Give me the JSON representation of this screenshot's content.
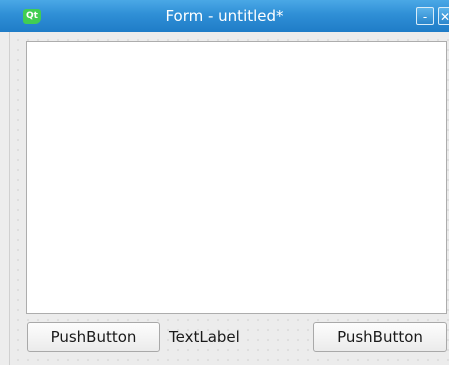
{
  "window": {
    "title": "Form - untitled*",
    "app_icon_text": "Qt",
    "minimize_glyph": "-",
    "close_glyph": "✕"
  },
  "form": {
    "left_button_label": "PushButton",
    "label_text": "TextLabel",
    "right_button_label": "PushButton",
    "text_edit_value": ""
  },
  "icons": {
    "app": "qt-logo-icon",
    "minimize": "minimize-icon",
    "close": "close-icon"
  },
  "colors": {
    "titlebar": "#2f8fd6",
    "qt_green": "#41cd52",
    "form_background": "#ececec"
  }
}
